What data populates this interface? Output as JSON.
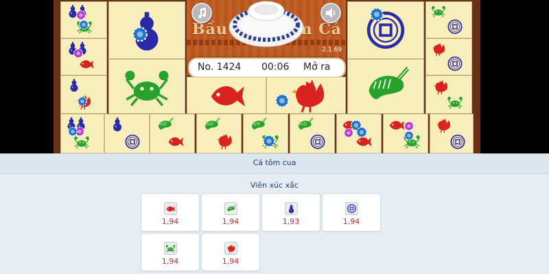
{
  "game": {
    "title": "Bầu Cua Tôm Cá",
    "version": "2.1.69",
    "round_label": "No. 1424",
    "timer": "00:06",
    "state": "Mở ra",
    "colors": {
      "board": "#6a2f17",
      "tile": "#f7eebc",
      "title_panel": "#c05a1e",
      "symbol_red": "#d8231e",
      "symbol_green": "#27a32b",
      "symbol_blue": "#2a2aa8"
    }
  },
  "market": {
    "label": "Cá tôm cua"
  },
  "dice_section": {
    "heading": "Viên xúc xắc",
    "options": [
      {
        "icon": "fish-icon",
        "odds": "1,94"
      },
      {
        "icon": "shrimp-icon",
        "odds": "1,94"
      },
      {
        "icon": "gourd-icon",
        "odds": "1,93"
      },
      {
        "icon": "coin-icon",
        "odds": "1,94"
      },
      {
        "icon": "crab-icon",
        "odds": "1,94"
      },
      {
        "icon": "rooster-icon",
        "odds": "1,94"
      }
    ]
  }
}
